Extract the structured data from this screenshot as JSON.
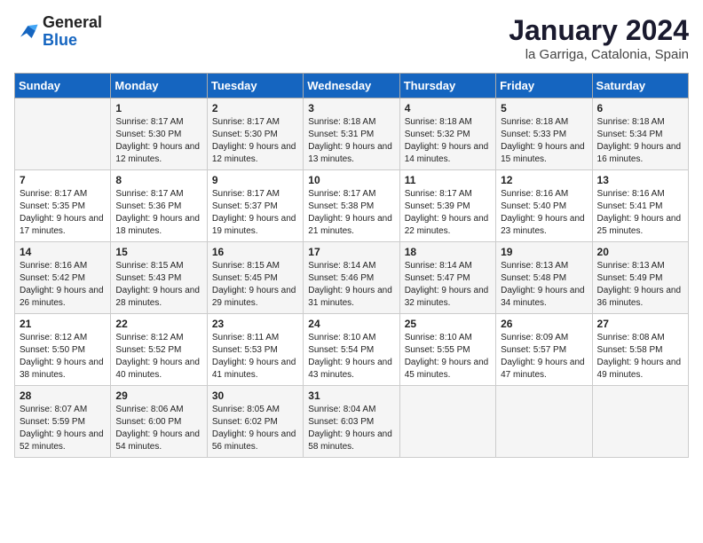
{
  "logo": {
    "general": "General",
    "blue": "Blue"
  },
  "header": {
    "month": "January 2024",
    "location": "la Garriga, Catalonia, Spain"
  },
  "weekdays": [
    "Sunday",
    "Monday",
    "Tuesday",
    "Wednesday",
    "Thursday",
    "Friday",
    "Saturday"
  ],
  "weeks": [
    [
      {
        "day": "",
        "sunrise": "",
        "sunset": "",
        "daylight": ""
      },
      {
        "day": "1",
        "sunrise": "Sunrise: 8:17 AM",
        "sunset": "Sunset: 5:30 PM",
        "daylight": "Daylight: 9 hours and 12 minutes."
      },
      {
        "day": "2",
        "sunrise": "Sunrise: 8:17 AM",
        "sunset": "Sunset: 5:30 PM",
        "daylight": "Daylight: 9 hours and 12 minutes."
      },
      {
        "day": "3",
        "sunrise": "Sunrise: 8:18 AM",
        "sunset": "Sunset: 5:31 PM",
        "daylight": "Daylight: 9 hours and 13 minutes."
      },
      {
        "day": "4",
        "sunrise": "Sunrise: 8:18 AM",
        "sunset": "Sunset: 5:32 PM",
        "daylight": "Daylight: 9 hours and 14 minutes."
      },
      {
        "day": "5",
        "sunrise": "Sunrise: 8:18 AM",
        "sunset": "Sunset: 5:33 PM",
        "daylight": "Daylight: 9 hours and 15 minutes."
      },
      {
        "day": "6",
        "sunrise": "Sunrise: 8:18 AM",
        "sunset": "Sunset: 5:34 PM",
        "daylight": "Daylight: 9 hours and 16 minutes."
      }
    ],
    [
      {
        "day": "7",
        "sunrise": "Sunrise: 8:17 AM",
        "sunset": "Sunset: 5:35 PM",
        "daylight": "Daylight: 9 hours and 17 minutes."
      },
      {
        "day": "8",
        "sunrise": "Sunrise: 8:17 AM",
        "sunset": "Sunset: 5:36 PM",
        "daylight": "Daylight: 9 hours and 18 minutes."
      },
      {
        "day": "9",
        "sunrise": "Sunrise: 8:17 AM",
        "sunset": "Sunset: 5:37 PM",
        "daylight": "Daylight: 9 hours and 19 minutes."
      },
      {
        "day": "10",
        "sunrise": "Sunrise: 8:17 AM",
        "sunset": "Sunset: 5:38 PM",
        "daylight": "Daylight: 9 hours and 21 minutes."
      },
      {
        "day": "11",
        "sunrise": "Sunrise: 8:17 AM",
        "sunset": "Sunset: 5:39 PM",
        "daylight": "Daylight: 9 hours and 22 minutes."
      },
      {
        "day": "12",
        "sunrise": "Sunrise: 8:16 AM",
        "sunset": "Sunset: 5:40 PM",
        "daylight": "Daylight: 9 hours and 23 minutes."
      },
      {
        "day": "13",
        "sunrise": "Sunrise: 8:16 AM",
        "sunset": "Sunset: 5:41 PM",
        "daylight": "Daylight: 9 hours and 25 minutes."
      }
    ],
    [
      {
        "day": "14",
        "sunrise": "Sunrise: 8:16 AM",
        "sunset": "Sunset: 5:42 PM",
        "daylight": "Daylight: 9 hours and 26 minutes."
      },
      {
        "day": "15",
        "sunrise": "Sunrise: 8:15 AM",
        "sunset": "Sunset: 5:43 PM",
        "daylight": "Daylight: 9 hours and 28 minutes."
      },
      {
        "day": "16",
        "sunrise": "Sunrise: 8:15 AM",
        "sunset": "Sunset: 5:45 PM",
        "daylight": "Daylight: 9 hours and 29 minutes."
      },
      {
        "day": "17",
        "sunrise": "Sunrise: 8:14 AM",
        "sunset": "Sunset: 5:46 PM",
        "daylight": "Daylight: 9 hours and 31 minutes."
      },
      {
        "day": "18",
        "sunrise": "Sunrise: 8:14 AM",
        "sunset": "Sunset: 5:47 PM",
        "daylight": "Daylight: 9 hours and 32 minutes."
      },
      {
        "day": "19",
        "sunrise": "Sunrise: 8:13 AM",
        "sunset": "Sunset: 5:48 PM",
        "daylight": "Daylight: 9 hours and 34 minutes."
      },
      {
        "day": "20",
        "sunrise": "Sunrise: 8:13 AM",
        "sunset": "Sunset: 5:49 PM",
        "daylight": "Daylight: 9 hours and 36 minutes."
      }
    ],
    [
      {
        "day": "21",
        "sunrise": "Sunrise: 8:12 AM",
        "sunset": "Sunset: 5:50 PM",
        "daylight": "Daylight: 9 hours and 38 minutes."
      },
      {
        "day": "22",
        "sunrise": "Sunrise: 8:12 AM",
        "sunset": "Sunset: 5:52 PM",
        "daylight": "Daylight: 9 hours and 40 minutes."
      },
      {
        "day": "23",
        "sunrise": "Sunrise: 8:11 AM",
        "sunset": "Sunset: 5:53 PM",
        "daylight": "Daylight: 9 hours and 41 minutes."
      },
      {
        "day": "24",
        "sunrise": "Sunrise: 8:10 AM",
        "sunset": "Sunset: 5:54 PM",
        "daylight": "Daylight: 9 hours and 43 minutes."
      },
      {
        "day": "25",
        "sunrise": "Sunrise: 8:10 AM",
        "sunset": "Sunset: 5:55 PM",
        "daylight": "Daylight: 9 hours and 45 minutes."
      },
      {
        "day": "26",
        "sunrise": "Sunrise: 8:09 AM",
        "sunset": "Sunset: 5:57 PM",
        "daylight": "Daylight: 9 hours and 47 minutes."
      },
      {
        "day": "27",
        "sunrise": "Sunrise: 8:08 AM",
        "sunset": "Sunset: 5:58 PM",
        "daylight": "Daylight: 9 hours and 49 minutes."
      }
    ],
    [
      {
        "day": "28",
        "sunrise": "Sunrise: 8:07 AM",
        "sunset": "Sunset: 5:59 PM",
        "daylight": "Daylight: 9 hours and 52 minutes."
      },
      {
        "day": "29",
        "sunrise": "Sunrise: 8:06 AM",
        "sunset": "Sunset: 6:00 PM",
        "daylight": "Daylight: 9 hours and 54 minutes."
      },
      {
        "day": "30",
        "sunrise": "Sunrise: 8:05 AM",
        "sunset": "Sunset: 6:02 PM",
        "daylight": "Daylight: 9 hours and 56 minutes."
      },
      {
        "day": "31",
        "sunrise": "Sunrise: 8:04 AM",
        "sunset": "Sunset: 6:03 PM",
        "daylight": "Daylight: 9 hours and 58 minutes."
      },
      {
        "day": "",
        "sunrise": "",
        "sunset": "",
        "daylight": ""
      },
      {
        "day": "",
        "sunrise": "",
        "sunset": "",
        "daylight": ""
      },
      {
        "day": "",
        "sunrise": "",
        "sunset": "",
        "daylight": ""
      }
    ]
  ]
}
